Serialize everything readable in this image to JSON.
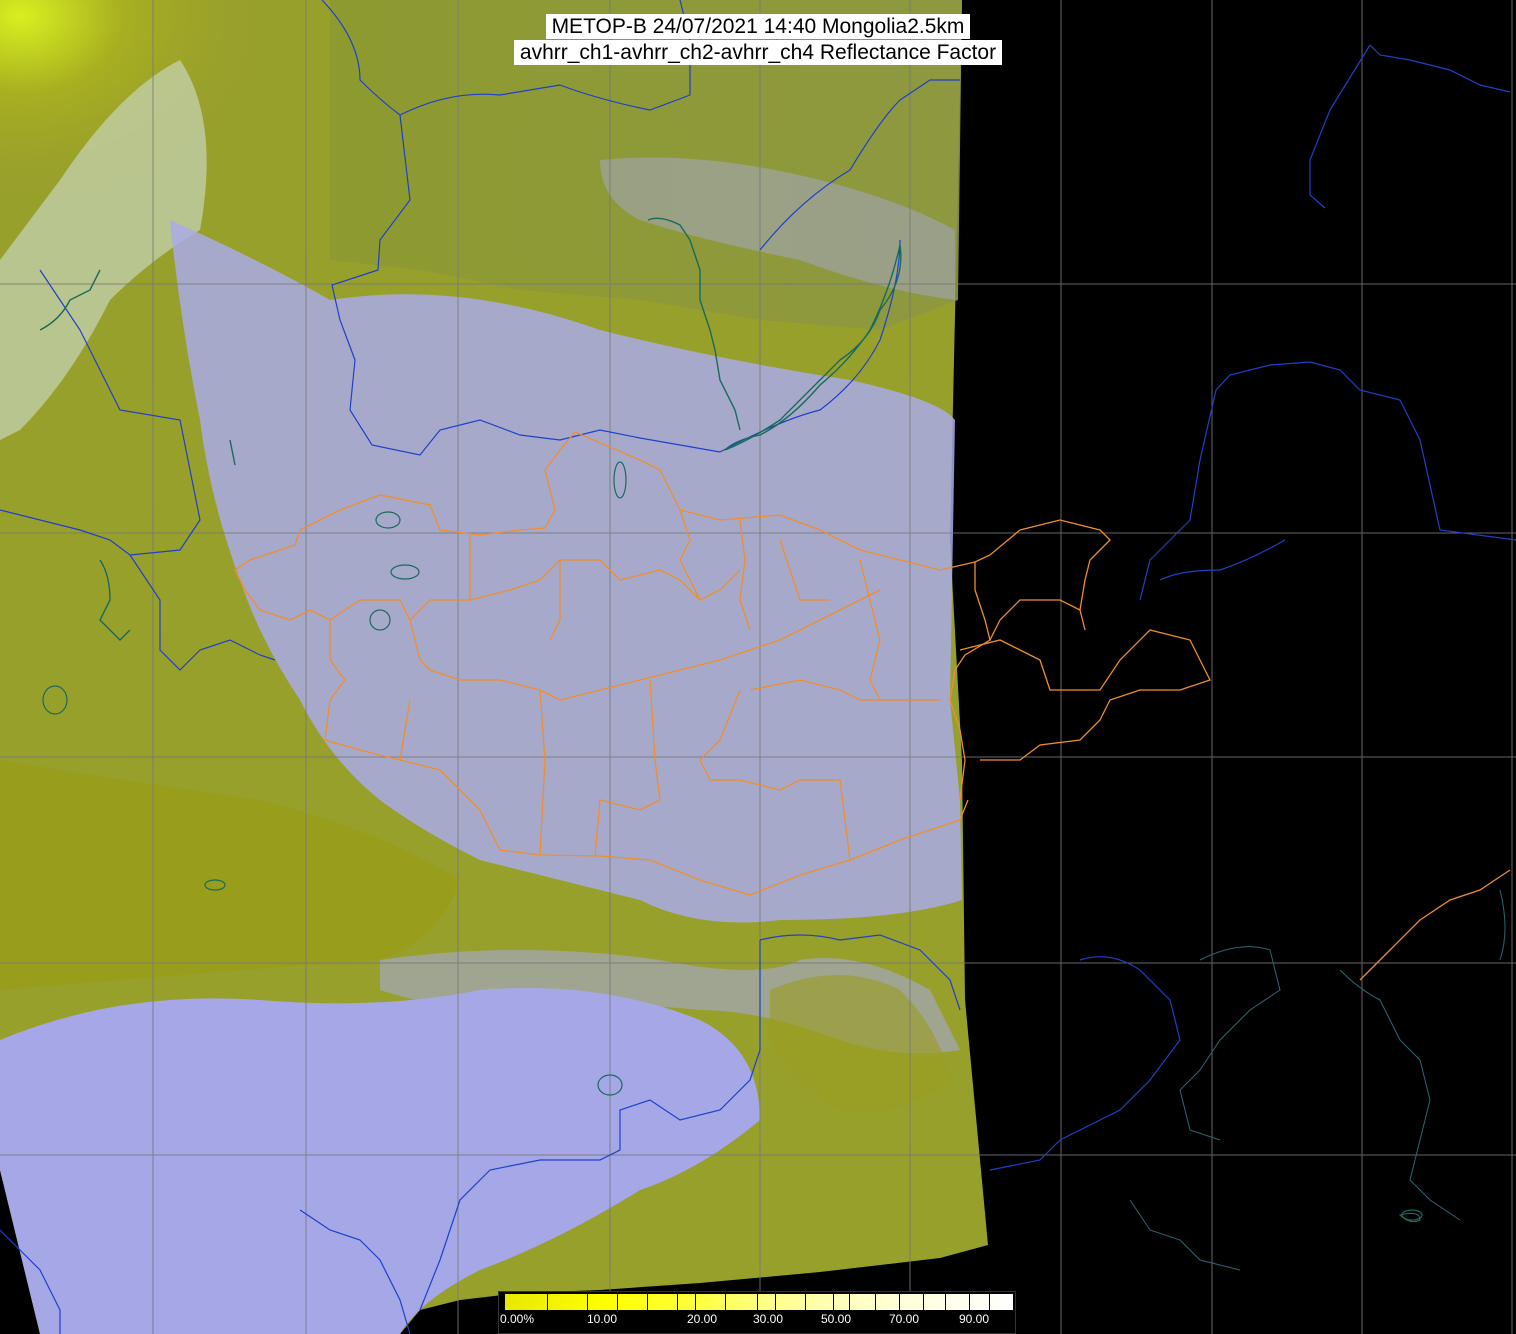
{
  "title": {
    "line1": "METOP-B 24/07/2021 14:40 Mongolia2.5km",
    "line2": "avhrr_ch1-avhrr_ch2-avhrr_ch4 Reflectance Factor"
  },
  "legend": {
    "labels": [
      "0.00%",
      "10.00",
      "20.00",
      "30.00",
      "50.00",
      "70.00",
      "90.00"
    ]
  },
  "colors": {
    "background": "#000000",
    "surface": "#9a9e2a",
    "cloud": "#a7a9ef",
    "coast": "#1c4dc8",
    "admin_border": "#f0922c",
    "grid": "#7a7a7a"
  }
}
